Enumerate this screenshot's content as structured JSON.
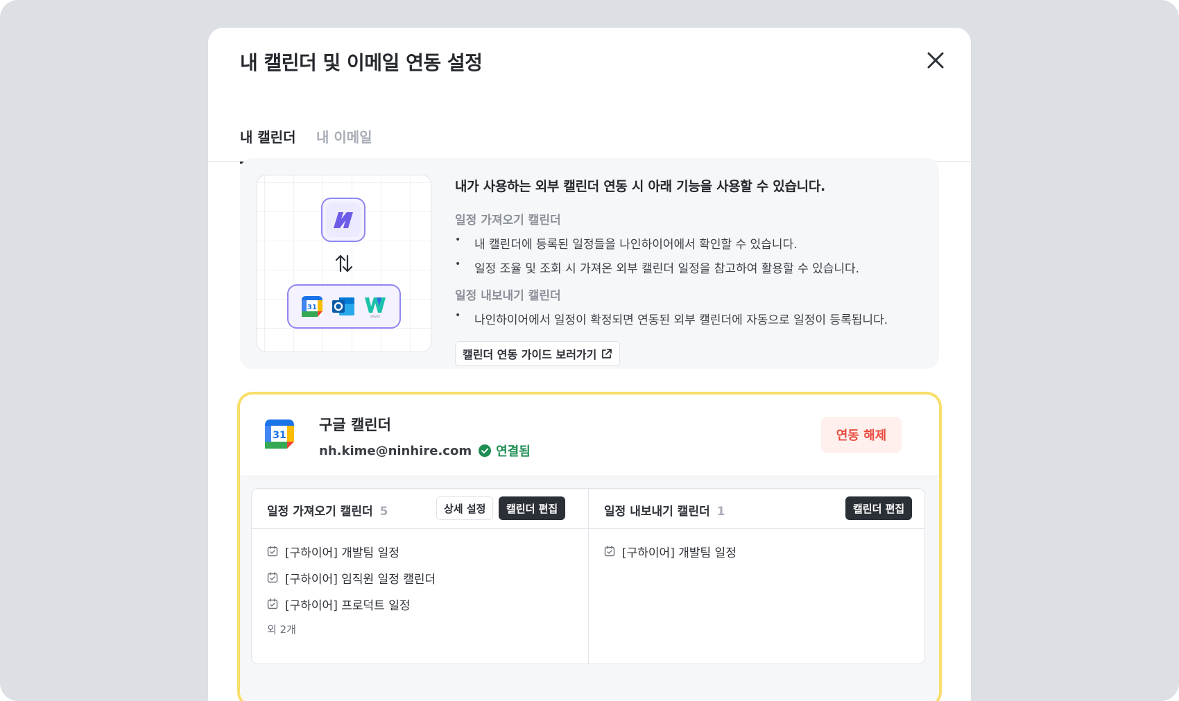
{
  "modal": {
    "title": "내 캘린더 및 이메일 연동 설정"
  },
  "tabs": [
    {
      "label": "내 캘린더",
      "active": true
    },
    {
      "label": "내 이메일",
      "active": false
    }
  ],
  "info": {
    "headline": "내가 사용하는 외부 캘린더 연동 시 아래 기능을 사용할 수 있습니다.",
    "import_label": "일정 가져오기 캘린더",
    "import_bullets": [
      "내 캘린더에 등록된 일정들을 나인하이어에서 확인할 수 있습니다.",
      "일정 조율 및 조회 시 가져온 외부 캘린더 일정을 참고하여 활용할 수 있습니다."
    ],
    "export_label": "일정 내보내기 캘린더",
    "export_bullets": [
      "나인하이어에서 일정이 확정되면 연동된 외부 캘린더에 자동으로 일정이 등록됩니다."
    ],
    "guide_button": "캘린더 연동 가이드 보러가기",
    "illustration": {
      "apps": [
        "google-calendar-icon",
        "outlook-icon",
        "whale-works-icon"
      ],
      "app_sub_label": "WAVER"
    }
  },
  "google_calendar": {
    "title": "구글 캘린더",
    "icon_day": "31",
    "email": "nh.kime@ninhire.com",
    "status": "연결됨",
    "disconnect_button": "연동 해제",
    "import_panel": {
      "title": "일정 가져오기 캘린더",
      "count": "5",
      "detail_button": "상세 설정",
      "edit_button": "캘린더 편집",
      "items": [
        "[구하이어] 개발팀 일정",
        "[구하이어] 임직원 일정 캘린더",
        "[구하이어] 프로덕트 일정"
      ],
      "more": "외 2개"
    },
    "export_panel": {
      "title": "일정 내보내기 캘린더",
      "count": "1",
      "edit_button": "캘린더 편집",
      "items": [
        "[구하이어] 개발팀 일정"
      ]
    }
  },
  "colors": {
    "backdrop": "#dcdfe4",
    "accent_purple": "#8e86f0",
    "highlight_yellow": "#f8de6a",
    "danger": "#e84b3e",
    "success": "#1e8e52",
    "dark_button": "#2b2f36"
  }
}
